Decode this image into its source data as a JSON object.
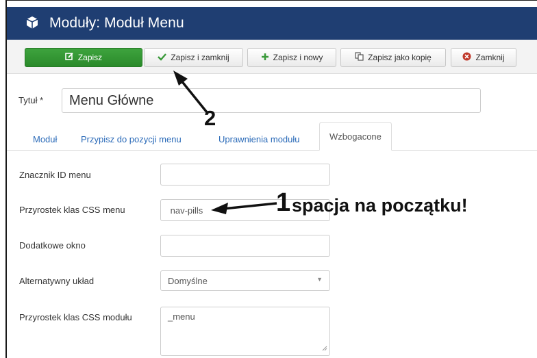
{
  "app": {
    "title": "Moduły: Moduł Menu",
    "header_color": "#1f3e72"
  },
  "toolbar": {
    "save_label": "Zapisz",
    "save_close_label": "Zapisz i zamknij",
    "save_new_label": "Zapisz i nowy",
    "save_copy_label": "Zapisz jako kopię",
    "close_label": "Zamknij",
    "icons": [
      "edit-icon",
      "check-icon",
      "plus-icon",
      "copy-icon",
      "close-circle-icon"
    ],
    "primary_color": "#2e8f2e"
  },
  "form": {
    "title_label": "Tytuł *",
    "title_value": "Menu Główne"
  },
  "tabs": [
    {
      "label": "Moduł"
    },
    {
      "label": "Przypisz do pozycji menu"
    },
    {
      "label": "Uprawnienia modułu"
    },
    {
      "label": "Wzbogacone"
    }
  ],
  "advanced": {
    "menu_tag_id_label": "Znacznik ID menu",
    "menu_tag_id_value": "",
    "menu_class_suffix_label": "Przyrostek klas CSS menu",
    "menu_class_suffix_value": " nav-pills",
    "target_position_label": "Dodatkowe okno",
    "target_position_value": "",
    "layout_label": "Alternatywny układ",
    "layout_value": "Domyślne",
    "module_class_suffix_label": "Przyrostek klas CSS modułu",
    "module_class_suffix_value": "_menu"
  },
  "annotations": {
    "number_1": "1",
    "note_1": "spacja na początku!",
    "number_2": "2"
  }
}
